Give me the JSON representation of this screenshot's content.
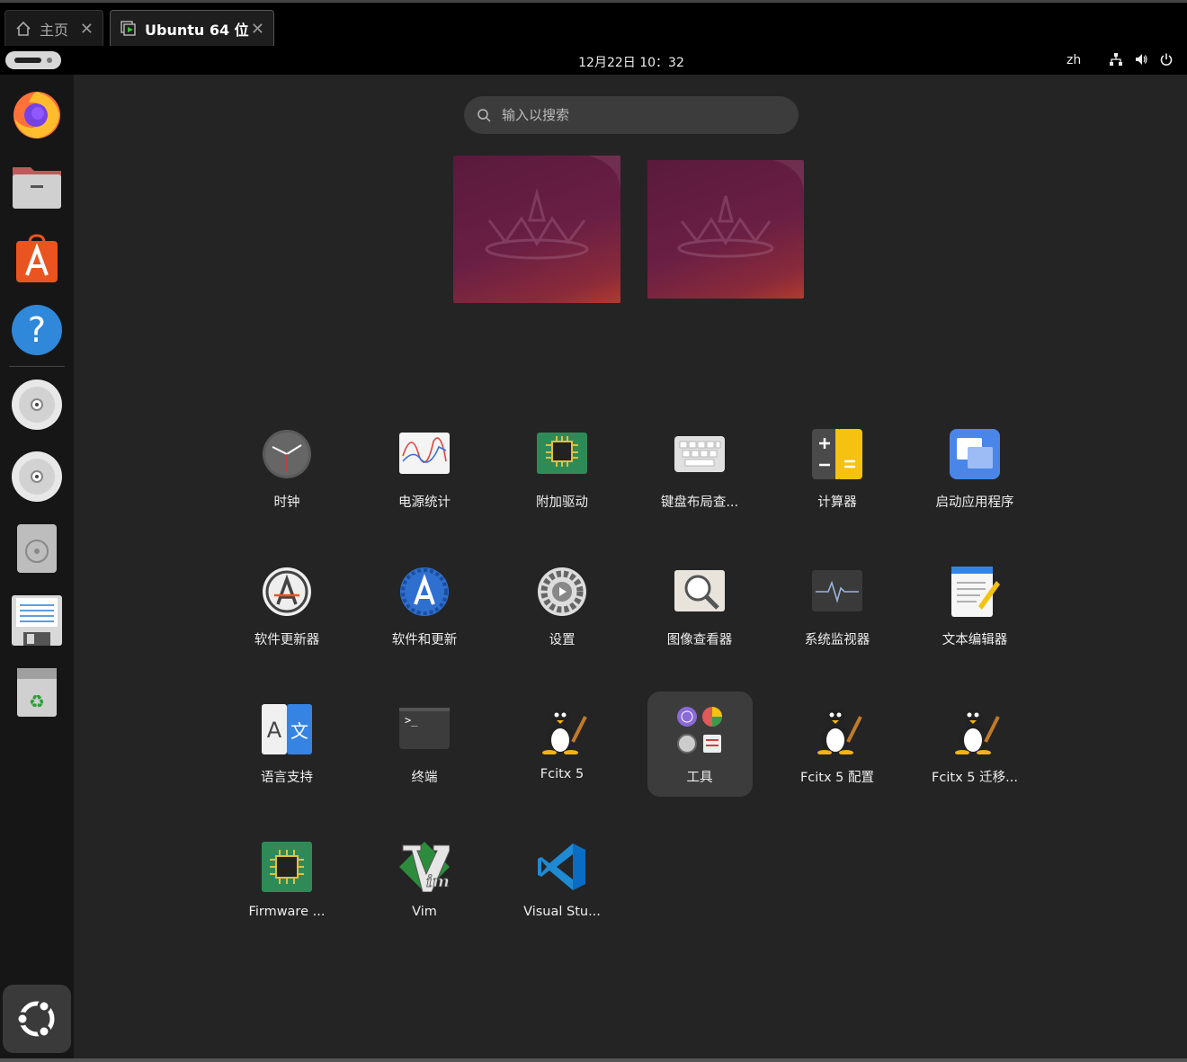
{
  "host": {
    "tabs": [
      {
        "label": "主页",
        "icon": "home-icon"
      },
      {
        "label": "Ubuntu 64 位",
        "icon": "vm-icon"
      }
    ]
  },
  "topbar": {
    "clock": "12月22日  10：32",
    "language": "zh",
    "tray_icons": [
      "network-icon",
      "volume-icon",
      "power-icon"
    ]
  },
  "dock": {
    "items": [
      {
        "name": "Firefox",
        "icon": "firefox-icon"
      },
      {
        "name": "Files",
        "icon": "files-icon"
      },
      {
        "name": "App Center",
        "icon": "app-center-icon"
      },
      {
        "name": "Help",
        "icon": "help-icon"
      },
      {
        "name": "CD drive 1",
        "icon": "cd-icon"
      },
      {
        "name": "CD drive 2",
        "icon": "cd-icon"
      },
      {
        "name": "Disk drive",
        "icon": "disk-icon"
      },
      {
        "name": "Floppy",
        "icon": "floppy-icon"
      },
      {
        "name": "Trash",
        "icon": "trash-icon"
      }
    ],
    "show_apps_icon": "ubuntu-apps-icon"
  },
  "search": {
    "placeholder": "输入以搜索"
  },
  "apps": [
    {
      "label": "时钟",
      "icon": "clock-icon"
    },
    {
      "label": "电源统计",
      "icon": "power-statistics-icon"
    },
    {
      "label": "附加驱动",
      "icon": "additional-drivers-icon"
    },
    {
      "label": "键盘布局查...",
      "icon": "keyboard-layout-icon"
    },
    {
      "label": "计算器",
      "icon": "calculator-icon"
    },
    {
      "label": "启动应用程序",
      "icon": "startup-apps-icon"
    },
    {
      "label": "软件更新器",
      "icon": "software-updater-icon"
    },
    {
      "label": "软件和更新",
      "icon": "software-updates-icon"
    },
    {
      "label": "设置",
      "icon": "settings-icon"
    },
    {
      "label": "图像查看器",
      "icon": "image-viewer-icon"
    },
    {
      "label": "系统监视器",
      "icon": "system-monitor-icon"
    },
    {
      "label": "文本编辑器",
      "icon": "text-editor-icon"
    },
    {
      "label": "语言支持",
      "icon": "language-support-icon"
    },
    {
      "label": "终端",
      "icon": "terminal-icon"
    },
    {
      "label": "Fcitx 5",
      "icon": "fcitx-icon"
    },
    {
      "label": "工具",
      "icon": "tools-folder-icon"
    },
    {
      "label": "Fcitx 5 配置",
      "icon": "fcitx-icon"
    },
    {
      "label": "Fcitx 5 迁移...",
      "icon": "fcitx-icon"
    },
    {
      "label": "Firmware ...",
      "icon": "firmware-icon"
    },
    {
      "label": "Vim",
      "icon": "vim-icon"
    },
    {
      "label": "Visual Stu...",
      "icon": "vscode-icon"
    }
  ]
}
